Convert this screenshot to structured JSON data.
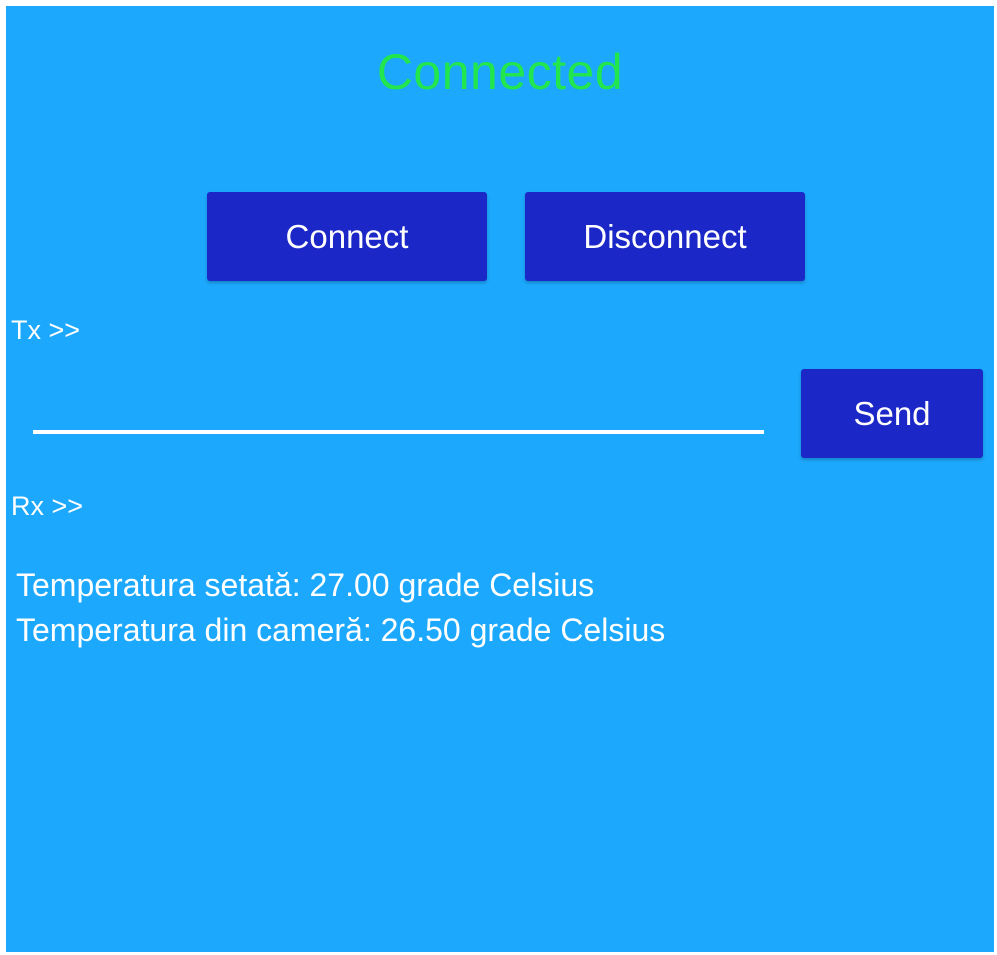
{
  "status": {
    "text": "Connected",
    "color": "#22e64d"
  },
  "buttons": {
    "connect_label": "Connect",
    "disconnect_label": "Disconnect",
    "send_label": "Send"
  },
  "tx": {
    "label": "Tx >>",
    "value": "",
    "placeholder": ""
  },
  "rx": {
    "label": "Rx >>",
    "lines": [
      "Temperatura setată: 27.00 grade Celsius",
      "Temperatura din cameră: 26.50 grade Celsius"
    ]
  },
  "colors": {
    "background": "#1ca8fd",
    "button": "#1b27c6",
    "text": "#ffffff"
  }
}
